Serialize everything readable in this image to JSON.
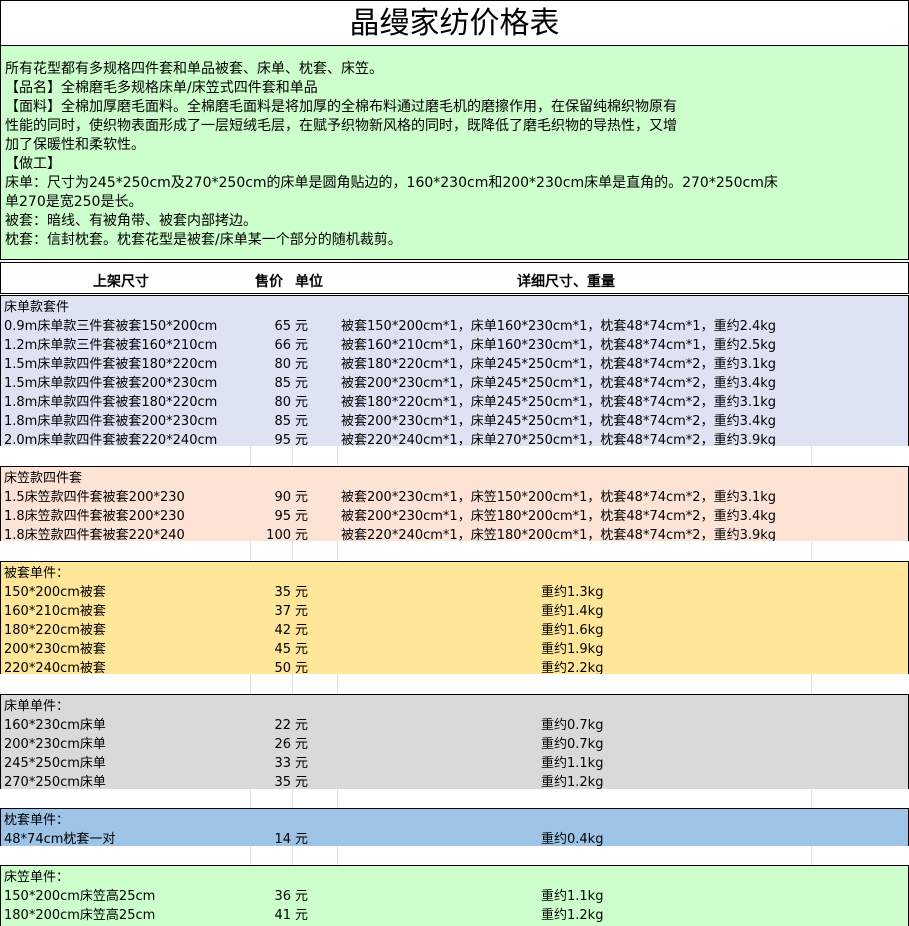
{
  "title": "晶缦家纺价格表",
  "intro": [
    "所有花型都有多规格四件套和单品被套、床单、枕套、床笠。",
    "【品名】全棉磨毛多规格床单/床笠式四件套和单品",
    "【面料】全棉加厚磨毛面料。全棉磨毛面料是将加厚的全棉布料通过磨毛机的磨擦作用，在保留纯棉织物原有",
    "性能的同时，使织物表面形成了一层短绒毛层，在赋予织物新风格的同时，既降低了磨毛织物的导热性，又增",
    "加了保暖性和柔软性。",
    "【做工】",
    "床单：尺寸为245*250cm及270*250cm的床单是圆角贴边的，160*230cm和200*230cm床单是直角的。270*250cm床",
    "单270是宽250是长。",
    "被套：暗线、有被角带、被套内部拷边。",
    "枕套：信封枕套。枕套花型是被套/床单某一个部分的随机裁剪。"
  ],
  "header": {
    "size": "上架尺寸",
    "price": "售价",
    "unit": "单位",
    "detail": "详细尺寸、重量"
  },
  "sections": {
    "sheet_sets": {
      "title": "床单款套件",
      "color": "#dde3f3",
      "rows": [
        {
          "name": "0.9m床单款三件套被套150*200cm",
          "price": "65",
          "unit": "元",
          "detail": "被套150*200cm*1，床单160*230cm*1，枕套48*74cm*1，重约2.4kg"
        },
        {
          "name": "1.2m床单款三件套被套160*210cm",
          "price": "66",
          "unit": "元",
          "detail": "被套160*210cm*1，床单160*230cm*1，枕套48*74cm*1，重约2.5kg"
        },
        {
          "name": "1.5m床单款四件套被套180*220cm",
          "price": "80",
          "unit": "元",
          "detail": "被套180*220cm*1，床单245*250cm*1，枕套48*74cm*2，重约3.1kg"
        },
        {
          "name": "1.5m床单款四件套被套200*230cm",
          "price": "85",
          "unit": "元",
          "detail": "被套200*230cm*1，床单245*250cm*1，枕套48*74cm*2，重约3.4kg"
        },
        {
          "name": "1.8m床单款四件套被套180*220cm",
          "price": "80",
          "unit": "元",
          "detail": "被套180*220cm*1，床单245*250cm*1，枕套48*74cm*2，重约3.1kg"
        },
        {
          "name": "1.8m床单款四件套被套200*230cm",
          "price": "85",
          "unit": "元",
          "detail": "被套200*230cm*1，床单245*250cm*1，枕套48*74cm*2，重约3.4kg"
        },
        {
          "name": "2.0m床单款四件套被套220*240cm",
          "price": "95",
          "unit": "元",
          "detail": "被套220*240cm*1，床单270*250cm*1，枕套48*74cm*2，重约3.9kg"
        }
      ]
    },
    "fitted_sets": {
      "title": "床笠款四件套",
      "color": "#fde3d6",
      "rows": [
        {
          "name": "1.5床笠款四件套被套200*230",
          "price": "90",
          "unit": "元",
          "detail": "被套200*230cm*1，床笠150*200cm*1，枕套48*74cm*2，重约3.1kg"
        },
        {
          "name": "1.8床笠款四件套被套200*230",
          "price": "95",
          "unit": "元",
          "detail": "被套200*230cm*1，床笠180*200cm*1，枕套48*74cm*2，重约3.4kg"
        },
        {
          "name": "1.8床笠款四件套被套220*240",
          "price": "100",
          "unit": "元",
          "detail": "被套220*240cm*1，床笠180*200cm*1，枕套48*74cm*2，重约3.9kg"
        }
      ]
    },
    "duvet": {
      "title": "被套单件：",
      "color": "#ffe699",
      "rows": [
        {
          "name": "150*200cm被套",
          "price": "35",
          "unit": "元",
          "weight": "重约1.3kg"
        },
        {
          "name": "160*210cm被套",
          "price": "37",
          "unit": "元",
          "weight": "重约1.4kg"
        },
        {
          "name": "180*220cm被套",
          "price": "42",
          "unit": "元",
          "weight": "重约1.6kg"
        },
        {
          "name": "200*230cm被套",
          "price": "45",
          "unit": "元",
          "weight": "重约1.9kg"
        },
        {
          "name": "220*240cm被套",
          "price": "50",
          "unit": "元",
          "weight": "重约2.2kg"
        }
      ]
    },
    "sheet": {
      "title": "床单单件：",
      "color": "#d9d9d9",
      "rows": [
        {
          "name": "160*230cm床单",
          "price": "22",
          "unit": "元",
          "weight": "重约0.7kg"
        },
        {
          "name": "200*230cm床单",
          "price": "26",
          "unit": "元",
          "weight": "重约0.7kg"
        },
        {
          "name": "245*250cm床单",
          "price": "33",
          "unit": "元",
          "weight": "重约1.1kg"
        },
        {
          "name": "270*250cm床单",
          "price": "35",
          "unit": "元",
          "weight": "重约1.2kg"
        }
      ]
    },
    "pillow": {
      "title": "枕套单件：",
      "color": "#9dc3e6",
      "rows": [
        {
          "name": "48*74cm枕套一对",
          "price": "14",
          "unit": "元",
          "weight": "重约0.4kg"
        }
      ]
    },
    "fitted": {
      "title": "床笠单件：",
      "color": "#ccffcc",
      "rows": [
        {
          "name": "150*200cm床笠高25cm",
          "price": "36",
          "unit": "元",
          "weight": "重约1.1kg"
        },
        {
          "name": "180*200cm床笠高25cm",
          "price": "41",
          "unit": "元",
          "weight": "重约1.2kg"
        }
      ]
    }
  }
}
